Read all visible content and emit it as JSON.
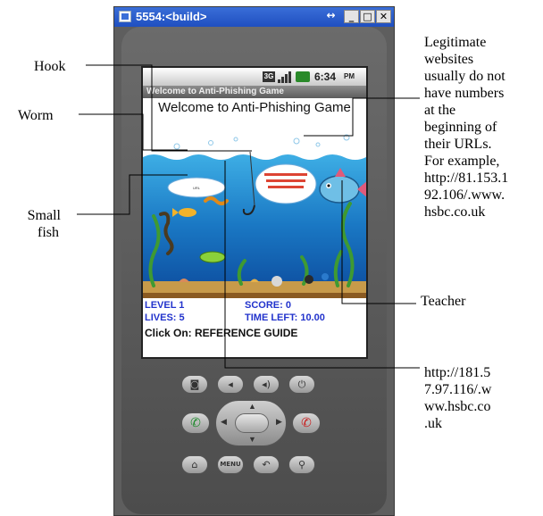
{
  "window": {
    "title": "5554:<build>",
    "restore_glyph": "↔",
    "minimize_glyph": "_",
    "maximize_glyph": "□",
    "close_glyph": "✕"
  },
  "status_bar": {
    "time": "6:34",
    "ampm": "PM",
    "network": "3G"
  },
  "app_title": "Welcome to Anti-Phishing Game",
  "welcome_heading": "Welcome to Anti-Phishing Game",
  "game": {
    "worm_url": "http://181.57.97.116/.www.hsbc.co.uk",
    "teacher_tip": "Legitimate websites usually do not have numbers at the beginning of their URLs.",
    "level": "LEVEL 1",
    "score": "SCORE: 0",
    "lives": "LIVES: 5",
    "time_left": "TIME LEFT: 10.00",
    "click_on": "Click On: REFERENCE GUIDE"
  },
  "annotations": {
    "hook": "Hook",
    "worm": "Worm",
    "small_fish_1": "Small",
    "small_fish_2": "fish",
    "teacher": "Teacher",
    "tip_lines": [
      "Legitimate",
      "websites",
      "usually do not",
      "have numbers",
      "at the",
      "beginning of",
      "their URLs.",
      "For example,",
      "http://81.153.1",
      "92.106/.www.",
      "hsbc.co.uk"
    ],
    "url_lines": [
      "http://181.5",
      "7.97.116/.w",
      "ww.hsbc.co",
      ".uk"
    ]
  },
  "colors": {
    "sea_top": "#2a9ad8",
    "sea_bottom": "#0e4fa0",
    "hud_blue": "#2233cc",
    "titlebar": "#2a5cc8"
  },
  "icons": [
    "camera-icon",
    "volume-down-icon",
    "volume-up-icon",
    "power-icon",
    "call-icon",
    "dpad-icon",
    "end-call-icon",
    "home-icon",
    "menu-icon",
    "back-icon",
    "search-icon"
  ]
}
